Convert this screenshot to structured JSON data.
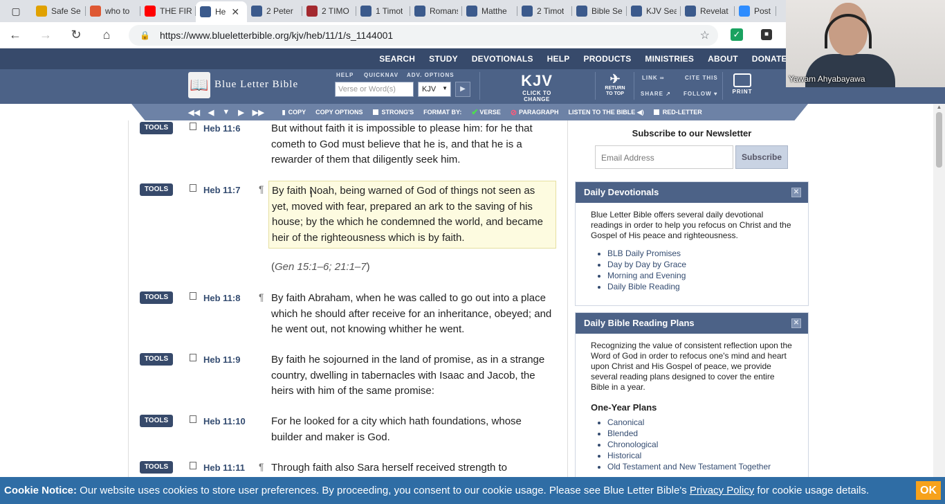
{
  "browser": {
    "tabs": [
      {
        "label": "Safe Se",
        "color": "#e0a100"
      },
      {
        "label": "who to",
        "color": "#de5833"
      },
      {
        "label": "THE FIR",
        "color": "#ff0000"
      },
      {
        "label": "He",
        "color": "#3b5a8c",
        "active": true
      },
      {
        "label": "2 Peter",
        "color": "#3b5a8c"
      },
      {
        "label": "2 TIMO",
        "color": "#a3292f"
      },
      {
        "label": "1 Timot",
        "color": "#3b5a8c"
      },
      {
        "label": "Romans",
        "color": "#3b5a8c"
      },
      {
        "label": "Matthe",
        "color": "#3b5a8c"
      },
      {
        "label": "2 Timot",
        "color": "#3b5a8c"
      },
      {
        "label": "Bible Se",
        "color": "#3b5a8c"
      },
      {
        "label": "KJV Sea",
        "color": "#3b5a8c"
      },
      {
        "label": "Revelat",
        "color": "#3b5a8c"
      },
      {
        "label": "Post A",
        "color": "#2d8cff"
      }
    ],
    "url": "https://www.blueletterbible.org/kjv/heb/11/1/s_1144001"
  },
  "webcam": {
    "name": "Yawam Ahyabayawa"
  },
  "nav": {
    "items": [
      "SEARCH",
      "STUDY",
      "DEVOTIONALS",
      "HELP",
      "PRODUCTS",
      "MINISTRIES",
      "ABOUT",
      "DONATE"
    ]
  },
  "header": {
    "logo_text": "Blue Letter Bible",
    "help": "HELP",
    "quicknav": "QUICKNAV",
    "adv_options": "ADV. OPTIONS",
    "search_placeholder": "Verse or Word(s)",
    "version": "KJV",
    "kjv_title": "KJV",
    "kjv_sub": "CLICK TO CHANGE",
    "return_top_1": "RETURN",
    "return_top_2": "TO TOP",
    "link": "LINK",
    "cite_this": "CITE THIS",
    "share": "SHARE",
    "follow": "FOLLOW",
    "print": "PRINT"
  },
  "toolbar": {
    "copy": "COPY",
    "copy_options": "COPY OPTIONS",
    "strongs": "STRONG'S",
    "format_by": "FORMAT BY:",
    "verse": "VERSE",
    "paragraph": "PARAGRAPH",
    "listen": "LISTEN TO THE BIBLE",
    "red_letter": "RED-LETTER"
  },
  "verses": [
    {
      "tools": "TOOLS",
      "ref": "Heb 11:6",
      "para": false,
      "text": "But without faith it is impossible to please him: for he that cometh to God must believe that he is, and that he is a rewarder of them that diligently seek him."
    },
    {
      "tools": "TOOLS",
      "ref": "Heb 11:7",
      "para": true,
      "highlight": true,
      "text": "By faith Noah, being warned of God of things not seen as yet, moved with fear, prepared an ark to the saving of his house; by the which he condemned the world, and became heir of the righteousness which is by faith.",
      "xref": "Gen 15:1–6; 21:1–7"
    },
    {
      "tools": "TOOLS",
      "ref": "Heb 11:8",
      "para": true,
      "text": "By faith Abraham, when he was called to go out into a place which he should after receive for an inheritance, obeyed; and he went out, not knowing whither he went."
    },
    {
      "tools": "TOOLS",
      "ref": "Heb 11:9",
      "para": false,
      "text": "By faith he sojourned in the land of promise, as in a strange country, dwelling in tabernacles with Isaac and Jacob, the heirs with him of the same promise:"
    },
    {
      "tools": "TOOLS",
      "ref": "Heb 11:10",
      "para": false,
      "text": "For he looked for a city which hath foundations, whose builder and maker is God."
    },
    {
      "tools": "TOOLS",
      "ref": "Heb 11:11",
      "para": true,
      "text": "Through faith also Sara herself received strength to"
    }
  ],
  "sidebar": {
    "newsletter_title": "Subscribe to our Newsletter",
    "email_placeholder": "Email Address",
    "subscribe": "Subscribe",
    "devotionals": {
      "title": "Daily Devotionals",
      "text": "Blue Letter Bible offers several daily devotional readings in order to help you refocus on Christ and the Gospel of His peace and righteousness.",
      "links": [
        "BLB Daily Promises",
        "Day by Day by Grace",
        "Morning and Evening",
        "Daily Bible Reading"
      ]
    },
    "plans": {
      "title": "Daily Bible Reading Plans",
      "text": "Recognizing the value of consistent reflection upon the Word of God in order to refocus one's mind and heart upon Christ and His Gospel of peace, we provide several reading plans designed to cover the entire Bible in a year.",
      "subtitle": "One-Year Plans",
      "links": [
        "Canonical",
        "Blended",
        "Chronological",
        "Historical",
        "Old Testament and New Testament Together"
      ]
    }
  },
  "cookie": {
    "title": "Cookie Notice:",
    "text1": " Our website uses cookies to store user preferences. By proceeding, you consent to our cookie usage. Please see Blue Letter Bible's ",
    "link": "Privacy Policy",
    "text2": " for cookie usage details.",
    "ok": "OK"
  }
}
